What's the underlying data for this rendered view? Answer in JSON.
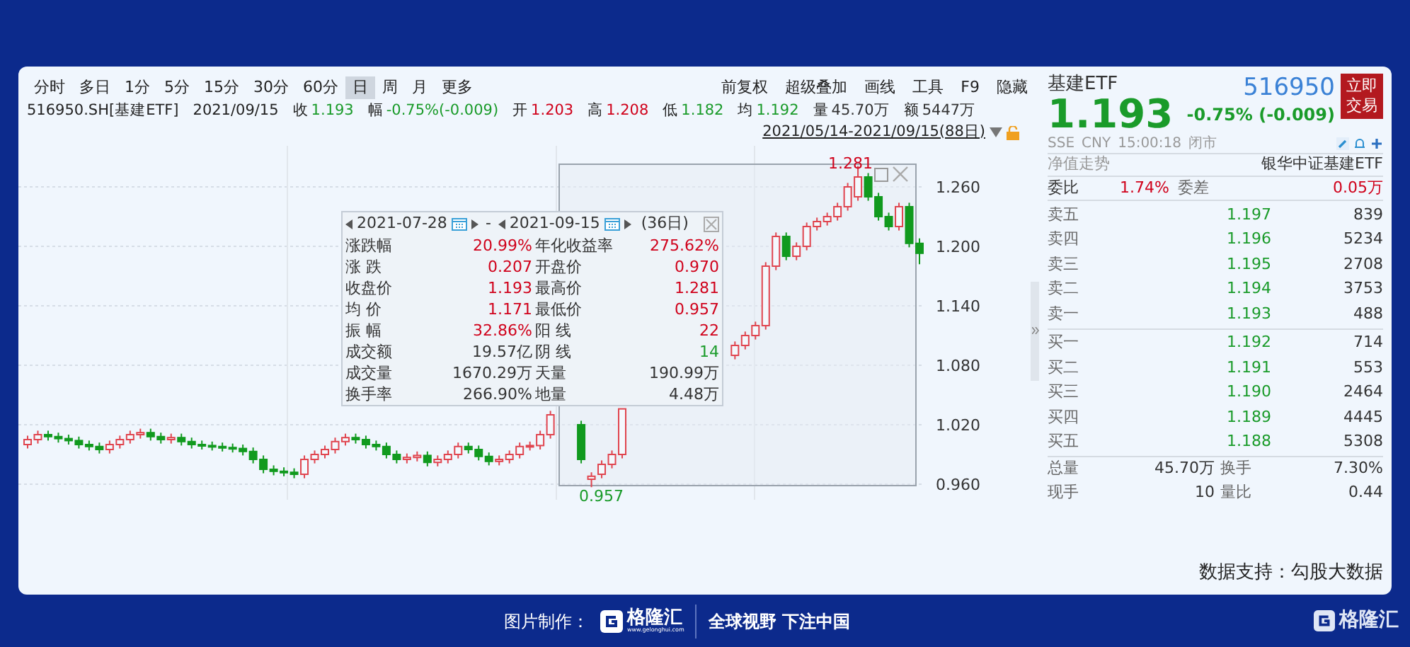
{
  "toolbar": {
    "periods": [
      {
        "label": "分时",
        "selected": false
      },
      {
        "label": "多日",
        "selected": false
      },
      {
        "label": "1分",
        "selected": false
      },
      {
        "label": "5分",
        "selected": false
      },
      {
        "label": "15分",
        "selected": false
      },
      {
        "label": "30分",
        "selected": false
      },
      {
        "label": "60分",
        "selected": false
      },
      {
        "label": "日",
        "selected": true
      },
      {
        "label": "周",
        "selected": false
      },
      {
        "label": "月",
        "selected": false
      },
      {
        "label": "更多",
        "selected": false
      }
    ],
    "tools": [
      "前复权",
      "超级叠加",
      "画线",
      "工具",
      "F9",
      "隐藏"
    ]
  },
  "info_bar": {
    "symbol": "516950.SH[基建ETF]",
    "date": "2021/09/15",
    "fields": [
      {
        "label": "收",
        "value": "1.193",
        "color": "#1a9b2a"
      },
      {
        "label": "幅",
        "value": "-0.75%(-0.009)",
        "color": "#1a9b2a"
      },
      {
        "label": "开",
        "value": "1.203",
        "color": "#d0021b"
      },
      {
        "label": "高",
        "value": "1.208",
        "color": "#d0021b"
      },
      {
        "label": "低",
        "value": "1.182",
        "color": "#1a9b2a"
      },
      {
        "label": "均",
        "value": "1.192",
        "color": "#1a9b2a"
      },
      {
        "label": "量",
        "value": "45.70万",
        "color": "#333333"
      },
      {
        "label": "额",
        "value": "5447万",
        "color": "#333333"
      }
    ]
  },
  "range": {
    "label": "2021/05/14-2021/09/15(88日)"
  },
  "chart": {
    "high_label": "1.281",
    "low_label": "0.957",
    "chart_data": {
      "type": "candlestick",
      "ylim": [
        0.945,
        1.3
      ],
      "grid": true,
      "yticks": [
        {
          "value": 1.26,
          "label": "1.260"
        },
        {
          "value": 1.2,
          "label": "1.200"
        },
        {
          "value": 1.14,
          "label": "1.140"
        },
        {
          "value": 1.08,
          "label": "1.080"
        },
        {
          "value": 1.02,
          "label": "1.020"
        },
        {
          "value": 0.96,
          "label": "0.960"
        }
      ],
      "ohlc": [
        [
          1.0,
          1.009,
          0.996,
          1.005
        ],
        [
          1.005,
          1.014,
          1.001,
          1.01
        ],
        [
          1.01,
          1.014,
          1.004,
          1.008
        ],
        [
          1.008,
          1.012,
          1.002,
          1.006
        ],
        [
          1.006,
          1.01,
          1.0,
          1.004
        ],
        [
          1.004,
          1.008,
          0.996,
          1.0
        ],
        [
          1.0,
          1.004,
          0.994,
          0.998
        ],
        [
          0.998,
          1.002,
          0.991,
          0.995
        ],
        [
          0.995,
          1.004,
          0.991,
          1.0
        ],
        [
          1.0,
          1.009,
          0.996,
          1.005
        ],
        [
          1.005,
          1.014,
          1.001,
          1.01
        ],
        [
          1.01,
          1.016,
          1.006,
          1.012
        ],
        [
          1.012,
          1.016,
          1.004,
          1.008
        ],
        [
          1.008,
          1.012,
          1.001,
          1.005
        ],
        [
          1.005,
          1.011,
          1.001,
          1.007
        ],
        [
          1.007,
          1.011,
          0.999,
          1.003
        ],
        [
          1.003,
          1.007,
          0.996,
          1.0
        ],
        [
          1.0,
          1.004,
          0.995,
          0.999
        ],
        [
          0.999,
          1.003,
          0.994,
          0.998
        ],
        [
          0.998,
          1.002,
          0.993,
          0.997
        ],
        [
          0.997,
          1.001,
          0.992,
          0.996
        ],
        [
          0.996,
          1.0,
          0.989,
          0.993
        ],
        [
          0.993,
          0.997,
          0.981,
          0.985
        ],
        [
          0.985,
          0.989,
          0.971,
          0.975
        ],
        [
          0.975,
          0.979,
          0.969,
          0.973
        ],
        [
          0.973,
          0.977,
          0.968,
          0.972
        ],
        [
          0.972,
          0.976,
          0.966,
          0.97
        ],
        [
          0.97,
          0.989,
          0.966,
          0.985
        ],
        [
          0.985,
          0.994,
          0.981,
          0.99
        ],
        [
          0.99,
          0.999,
          0.986,
          0.995
        ],
        [
          0.995,
          1.007,
          0.991,
          1.003
        ],
        [
          1.003,
          1.011,
          0.999,
          1.007
        ],
        [
          1.007,
          1.011,
          1.001,
          1.005
        ],
        [
          1.005,
          1.009,
          0.996,
          1.0
        ],
        [
          1.0,
          1.004,
          0.994,
          0.998
        ],
        [
          0.998,
          1.002,
          0.986,
          0.99
        ],
        [
          0.99,
          0.994,
          0.981,
          0.985
        ],
        [
          0.985,
          0.991,
          0.981,
          0.987
        ],
        [
          0.987,
          0.993,
          0.983,
          0.989
        ],
        [
          0.989,
          0.993,
          0.978,
          0.982
        ],
        [
          0.982,
          0.989,
          0.978,
          0.985
        ],
        [
          0.985,
          0.994,
          0.981,
          0.99
        ],
        [
          0.99,
          1.002,
          0.986,
          0.998
        ],
        [
          0.998,
          1.002,
          0.991,
          0.995
        ],
        [
          0.995,
          0.999,
          0.984,
          0.988
        ],
        [
          0.988,
          0.992,
          0.979,
          0.983
        ],
        [
          0.983,
          0.989,
          0.979,
          0.985
        ],
        [
          0.985,
          0.994,
          0.981,
          0.99
        ],
        [
          0.99,
          1.002,
          0.986,
          0.998
        ],
        [
          0.998,
          1.003,
          0.994,
          0.999
        ],
        [
          0.999,
          1.014,
          0.995,
          1.01
        ],
        [
          1.01,
          1.034,
          1.006,
          1.03
        ],
        null,
        null,
        [
          1.02,
          1.024,
          0.981,
          0.985
        ],
        [
          0.965,
          0.972,
          0.957,
          0.968
        ],
        [
          0.97,
          0.984,
          0.966,
          0.98
        ],
        [
          0.98,
          0.994,
          0.976,
          0.99
        ],
        [
          0.99,
          1.036,
          0.986,
          1.036
        ],
        null,
        null,
        null,
        null,
        null,
        null,
        null,
        null,
        null,
        null,
        [
          1.09,
          1.104,
          1.086,
          1.1
        ],
        [
          1.1,
          1.114,
          1.096,
          1.11
        ],
        [
          1.11,
          1.124,
          1.106,
          1.12
        ],
        [
          1.12,
          1.184,
          1.116,
          1.18
        ],
        [
          1.18,
          1.214,
          1.176,
          1.21
        ],
        [
          1.21,
          1.214,
          1.186,
          1.19
        ],
        [
          1.19,
          1.204,
          1.186,
          1.2
        ],
        [
          1.2,
          1.224,
          1.196,
          1.22
        ],
        [
          1.22,
          1.229,
          1.216,
          1.225
        ],
        [
          1.225,
          1.234,
          1.221,
          1.23
        ],
        [
          1.23,
          1.244,
          1.226,
          1.24
        ],
        [
          1.24,
          1.264,
          1.236,
          1.26
        ],
        [
          1.25,
          1.281,
          1.246,
          1.27
        ],
        [
          1.27,
          1.274,
          1.246,
          1.25
        ],
        [
          1.25,
          1.254,
          1.226,
          1.23
        ],
        [
          1.23,
          1.234,
          1.216,
          1.22
        ],
        [
          1.22,
          1.244,
          1.216,
          1.24
        ],
        [
          1.24,
          1.244,
          1.199,
          1.203
        ],
        [
          1.203,
          1.208,
          1.182,
          1.193
        ]
      ]
    }
  },
  "stats_popup": {
    "start_date": "2021-07-28",
    "separator": "-",
    "end_date": "2021-09-15",
    "days": "(36日)",
    "stats": [
      {
        "label": "涨跌幅",
        "value": "20.99%",
        "color": "#d0021b"
      },
      {
        "label": "年化收益率",
        "value": "275.62%",
        "color": "#d0021b"
      },
      {
        "label": "涨 跌",
        "value": "0.207",
        "color": "#d0021b"
      },
      {
        "label": "开盘价",
        "value": "0.970",
        "color": "#d0021b"
      },
      {
        "label": "收盘价",
        "value": "1.193",
        "color": "#d0021b"
      },
      {
        "label": "最高价",
        "value": "1.281",
        "color": "#d0021b"
      },
      {
        "label": "均 价",
        "value": "1.171",
        "color": "#d0021b"
      },
      {
        "label": "最低价",
        "value": "0.957",
        "color": "#d0021b"
      },
      {
        "label": "振 幅",
        "value": "32.86%",
        "color": "#d0021b"
      },
      {
        "label": "阳 线",
        "value": "22",
        "color": "#d0021b"
      },
      {
        "label": "成交额",
        "value": "19.57亿",
        "color": "#333333"
      },
      {
        "label": "阴 线",
        "value": "14",
        "color": "#1a9b2a"
      },
      {
        "label": "成交量",
        "value": "1670.29万",
        "color": "#333333"
      },
      {
        "label": "天量",
        "value": "190.99万",
        "color": "#333333"
      },
      {
        "label": "换手率",
        "value": "266.90%",
        "color": "#333333"
      },
      {
        "label": "地量",
        "value": "4.48万",
        "color": "#333333"
      }
    ]
  },
  "quote": {
    "name": "基建ETF",
    "code": "516950",
    "trade_button": "立即交易",
    "price": "1.193",
    "change": "-0.75% (-0.009)",
    "color": "#1a9b2a",
    "status": [
      "SSE",
      "CNY",
      "15:00:18",
      "闭市"
    ],
    "nav_label": "净值走势",
    "fund_name": "银华中证基建ETF",
    "ratio": {
      "label": "委比",
      "value": "1.74%",
      "label2": "委差",
      "value2": "0.05万"
    },
    "asks": [
      {
        "label": "卖五",
        "price": "1.197",
        "volume": "839"
      },
      {
        "label": "卖四",
        "price": "1.196",
        "volume": "5234"
      },
      {
        "label": "卖三",
        "price": "1.195",
        "volume": "2708"
      },
      {
        "label": "卖二",
        "price": "1.194",
        "volume": "3753"
      },
      {
        "label": "卖一",
        "price": "1.193",
        "volume": "488"
      }
    ],
    "bids": [
      {
        "label": "买一",
        "price": "1.192",
        "volume": "714"
      },
      {
        "label": "买二",
        "price": "1.191",
        "volume": "553"
      },
      {
        "label": "买三",
        "price": "1.190",
        "volume": "2464"
      },
      {
        "label": "买四",
        "price": "1.189",
        "volume": "4445"
      },
      {
        "label": "买五",
        "price": "1.188",
        "volume": "5308"
      }
    ],
    "totals": [
      {
        "label": "总量",
        "value": "45.70万",
        "label2": "换手",
        "value2": "7.30%"
      },
      {
        "label": "现手",
        "value": "10",
        "label2": "量比",
        "value2": "0.44"
      }
    ],
    "source": "数据支持：勾股大数据"
  },
  "footer": {
    "credit": "图片制作：",
    "logo": "格隆汇",
    "logo_url": "www.gelonghui.com",
    "slogan": "全球视野 下注中国",
    "corner_logo": "格隆汇"
  }
}
